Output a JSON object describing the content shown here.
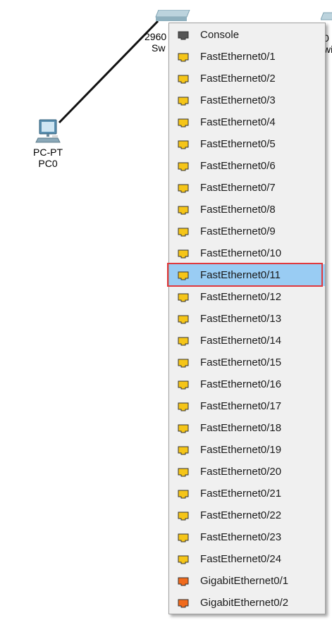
{
  "workspace": {
    "pc": {
      "type_label": "PC-PT",
      "name_label": "PC0"
    },
    "switch_left": {
      "line1": "2960",
      "line2": "Sw"
    },
    "switch_right": {
      "line1": "0",
      "line2": "wi"
    }
  },
  "port_menu": {
    "selected": "FastEthernet0/11",
    "items": [
      {
        "label": "Console",
        "icon": "console-port-icon",
        "color": "#555555"
      },
      {
        "label": "FastEthernet0/1",
        "icon": "ethernet-port-icon",
        "color": "#f5c518"
      },
      {
        "label": "FastEthernet0/2",
        "icon": "ethernet-port-icon",
        "color": "#f5c518"
      },
      {
        "label": "FastEthernet0/3",
        "icon": "ethernet-port-icon",
        "color": "#f5c518"
      },
      {
        "label": "FastEthernet0/4",
        "icon": "ethernet-port-icon",
        "color": "#f5c518"
      },
      {
        "label": "FastEthernet0/5",
        "icon": "ethernet-port-icon",
        "color": "#f5c518"
      },
      {
        "label": "FastEthernet0/6",
        "icon": "ethernet-port-icon",
        "color": "#f5c518"
      },
      {
        "label": "FastEthernet0/7",
        "icon": "ethernet-port-icon",
        "color": "#f5c518"
      },
      {
        "label": "FastEthernet0/8",
        "icon": "ethernet-port-icon",
        "color": "#f5c518"
      },
      {
        "label": "FastEthernet0/9",
        "icon": "ethernet-port-icon",
        "color": "#f5c518"
      },
      {
        "label": "FastEthernet0/10",
        "icon": "ethernet-port-icon",
        "color": "#f5c518"
      },
      {
        "label": "FastEthernet0/11",
        "icon": "ethernet-port-icon",
        "color": "#f5c518"
      },
      {
        "label": "FastEthernet0/12",
        "icon": "ethernet-port-icon",
        "color": "#f5c518"
      },
      {
        "label": "FastEthernet0/13",
        "icon": "ethernet-port-icon",
        "color": "#f5c518"
      },
      {
        "label": "FastEthernet0/14",
        "icon": "ethernet-port-icon",
        "color": "#f5c518"
      },
      {
        "label": "FastEthernet0/15",
        "icon": "ethernet-port-icon",
        "color": "#f5c518"
      },
      {
        "label": "FastEthernet0/16",
        "icon": "ethernet-port-icon",
        "color": "#f5c518"
      },
      {
        "label": "FastEthernet0/17",
        "icon": "ethernet-port-icon",
        "color": "#f5c518"
      },
      {
        "label": "FastEthernet0/18",
        "icon": "ethernet-port-icon",
        "color": "#f5c518"
      },
      {
        "label": "FastEthernet0/19",
        "icon": "ethernet-port-icon",
        "color": "#f5c518"
      },
      {
        "label": "FastEthernet0/20",
        "icon": "ethernet-port-icon",
        "color": "#f5c518"
      },
      {
        "label": "FastEthernet0/21",
        "icon": "ethernet-port-icon",
        "color": "#f5c518"
      },
      {
        "label": "FastEthernet0/22",
        "icon": "ethernet-port-icon",
        "color": "#f5c518"
      },
      {
        "label": "FastEthernet0/23",
        "icon": "ethernet-port-icon",
        "color": "#f5c518"
      },
      {
        "label": "FastEthernet0/24",
        "icon": "ethernet-port-icon",
        "color": "#f5c518"
      },
      {
        "label": "GigabitEthernet0/1",
        "icon": "gigabit-port-icon",
        "color": "#f06a1c"
      },
      {
        "label": "GigabitEthernet0/2",
        "icon": "gigabit-port-icon",
        "color": "#f06a1c"
      }
    ]
  },
  "colors": {
    "highlight_bg": "#99ccf3",
    "highlight_border": "#e0393e",
    "menu_bg": "#f0f0f0",
    "cable": "#111111"
  }
}
